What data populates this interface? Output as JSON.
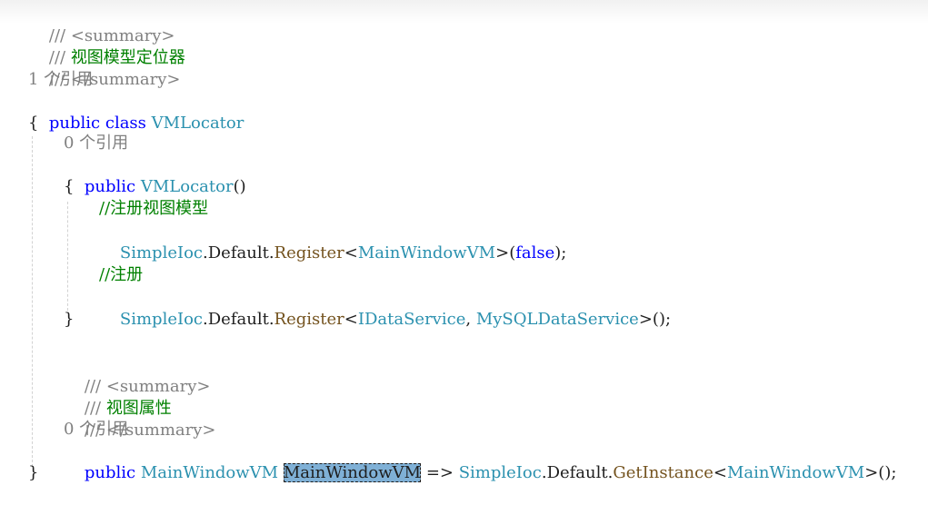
{
  "code": {
    "l1": {
      "slashes": "/// ",
      "tag": "<summary>"
    },
    "l2": {
      "slashes": "/// ",
      "text": "视图模型定位器"
    },
    "l3": {
      "slashes": "/// ",
      "tag": "</summary>"
    },
    "l4": {
      "refs": "1 个引用"
    },
    "l5": {
      "kw1": "public",
      "kw2": "class",
      "name": "VMLocator"
    },
    "l6": {
      "brace": "{"
    },
    "l7": {
      "refs": "0 个引用"
    },
    "l8": {
      "kw": "public",
      "name": "VMLocator",
      "parens": "()"
    },
    "l9": {
      "brace": "{"
    },
    "l10": {
      "comment": "//注册视图模型"
    },
    "l11": {
      "type": "SimpleIoc",
      "dot1": ".",
      "prop": "Default",
      "dot2": ".",
      "method": "Register",
      "lt": "<",
      "arg": "MainWindowVM",
      "gt": ">",
      "open": "(",
      "val": "false",
      "close": ");"
    },
    "l13": {
      "comment": "//注册"
    },
    "l14": {
      "type": "SimpleIoc",
      "dot1": ".",
      "prop": "Default",
      "dot2": ".",
      "method": "Register",
      "lt": "<",
      "arg1": "IDataService",
      "comma": ", ",
      "arg2": "MySQLDataService",
      "gt": ">",
      "call": "();"
    },
    "l15": {
      "brace": "}"
    },
    "l17": {
      "slashes": "/// ",
      "tag": "<summary>"
    },
    "l18": {
      "slashes": "/// ",
      "text": "视图属性"
    },
    "l19": {
      "slashes": "/// ",
      "tag": "</summary>"
    },
    "l20": {
      "refs": "0 个引用"
    },
    "l21": {
      "kw": "public",
      "type": "MainWindowVM",
      "name": "MainWindowVM",
      "arrow": " => ",
      "type2": "SimpleIoc",
      "dot1": ".",
      "prop": "Default",
      "dot2": ".",
      "method": "GetInstance",
      "lt": "<",
      "arg": "MainWindowVM",
      "gt": ">",
      "call": "();"
    },
    "l22": {
      "brace": "}"
    }
  }
}
